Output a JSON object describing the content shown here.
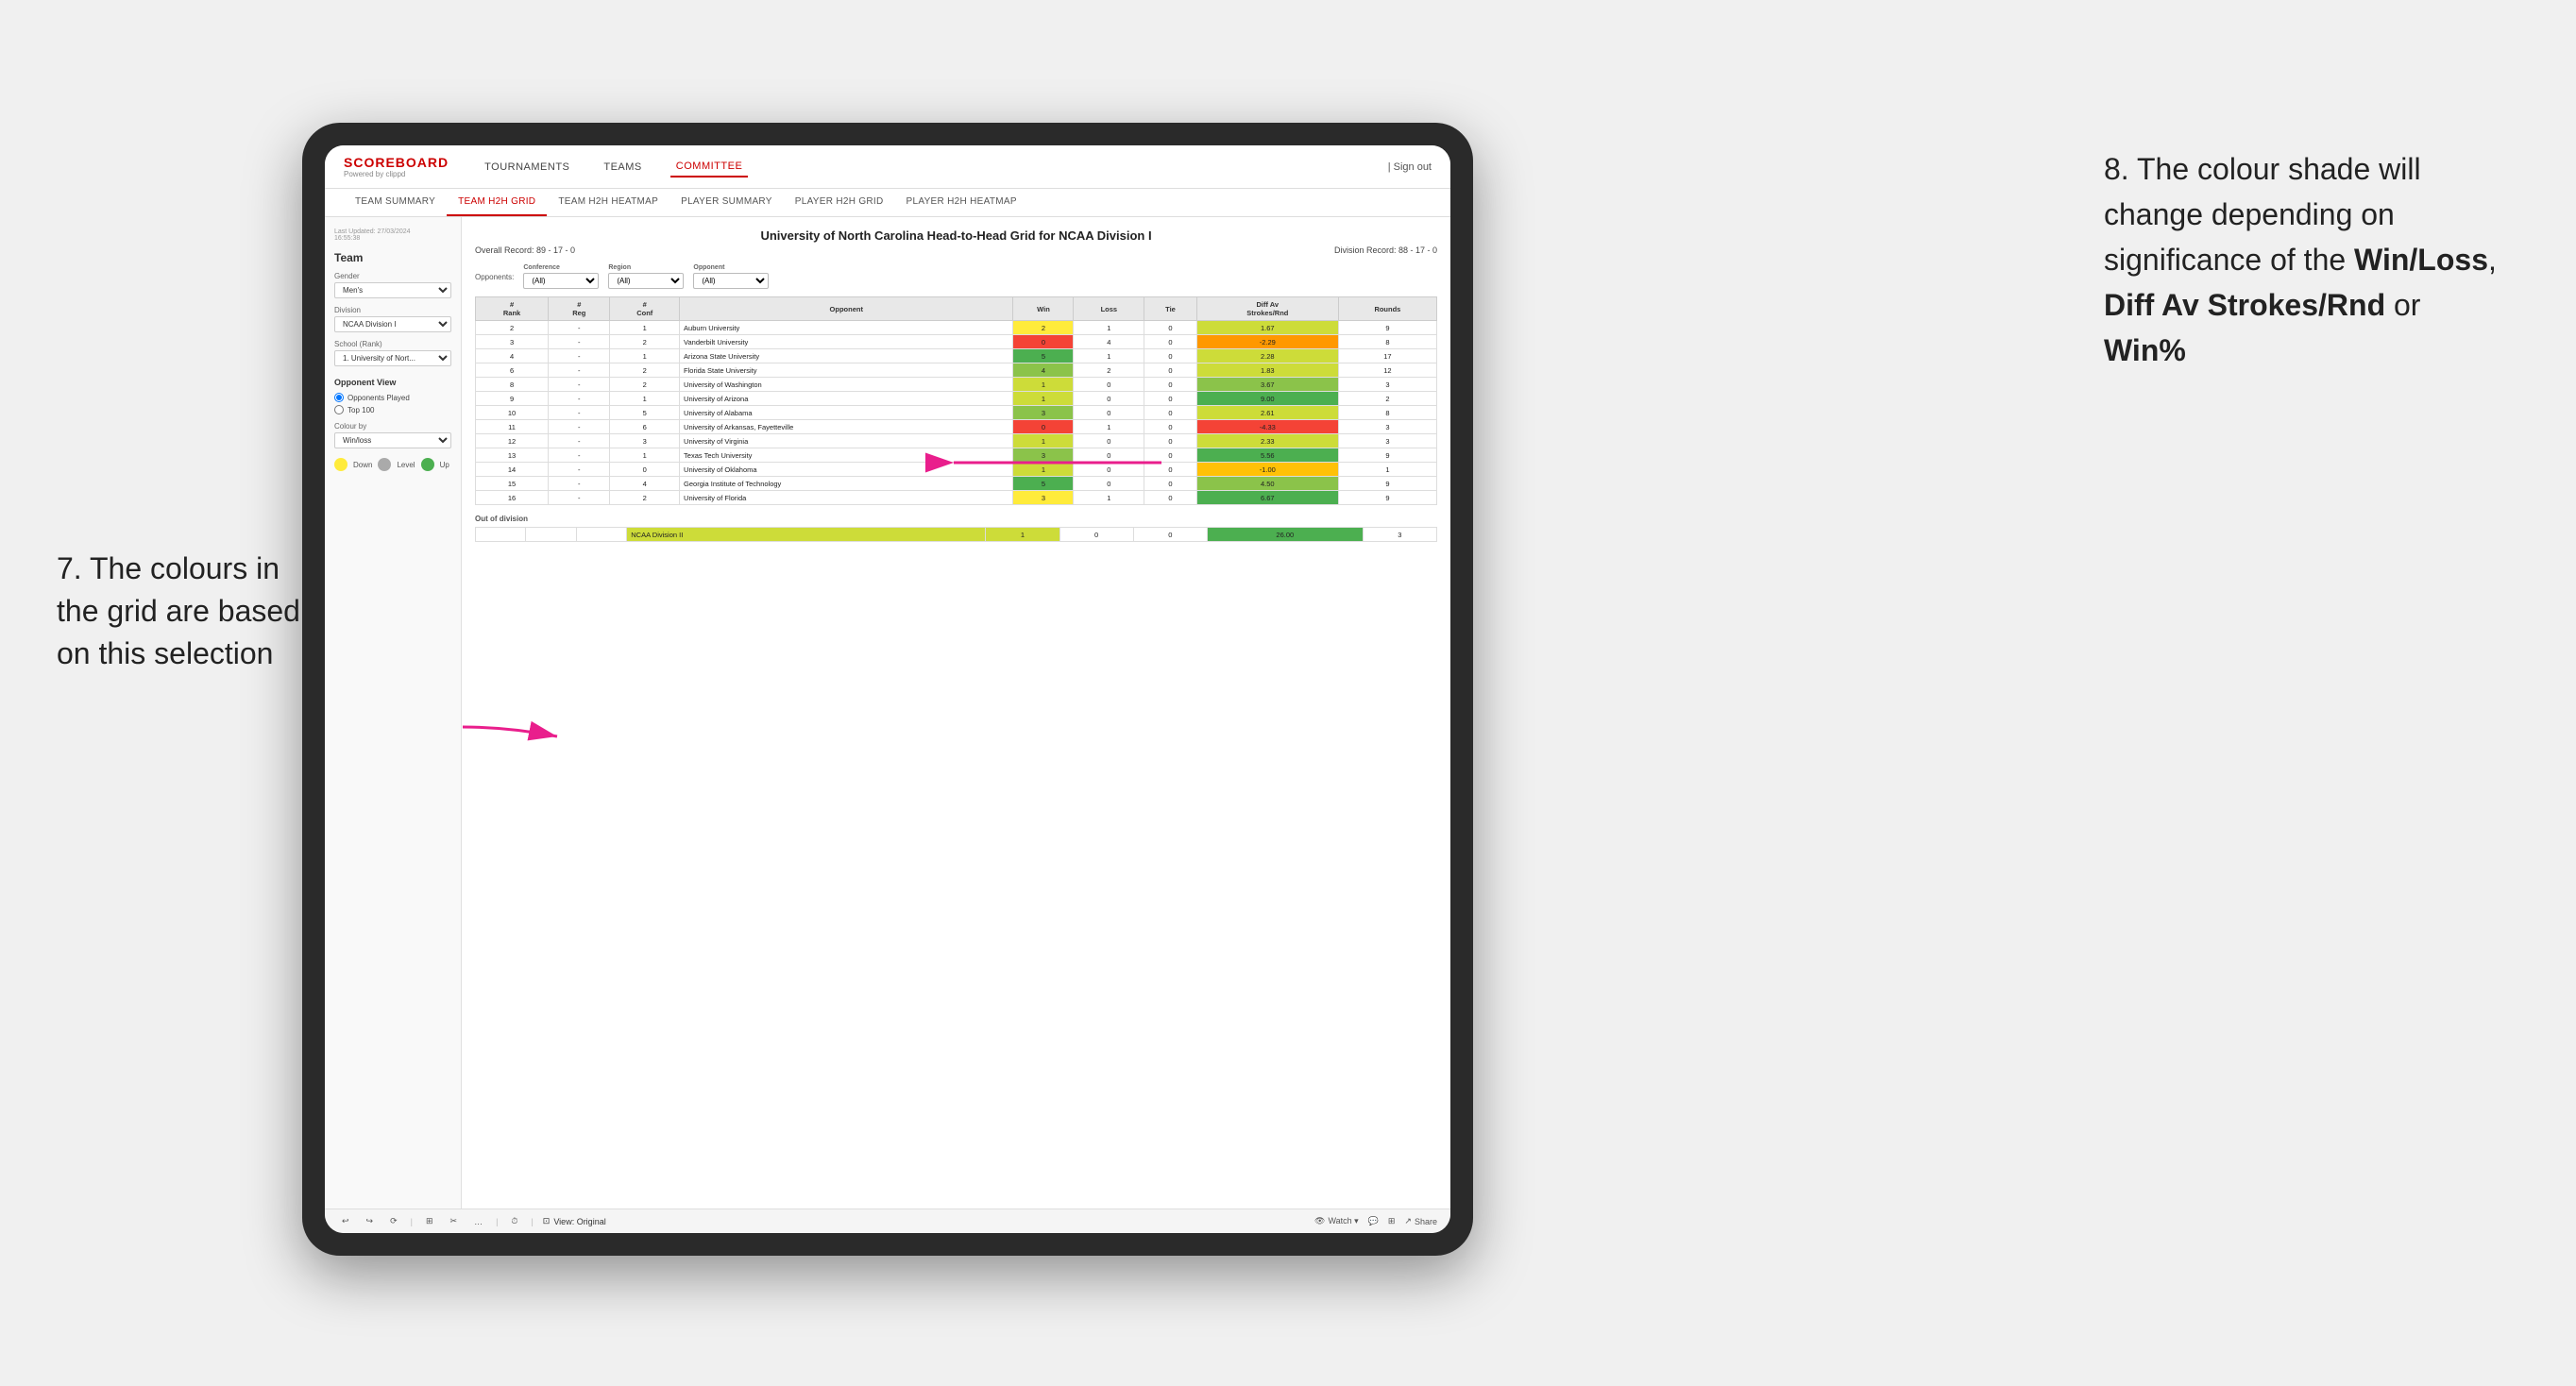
{
  "annotations": {
    "left": "7. The colours in the grid are based on this selection",
    "right_prefix": "8. The colour shade will change depending on significance of the ",
    "right_bold1": "Win/Loss",
    "right_sep1": ", ",
    "right_bold2": "Diff Av Strokes/Rnd",
    "right_sep2": " or ",
    "right_bold3": "Win%"
  },
  "nav": {
    "logo": "SCOREBOARD",
    "logo_sub": "Powered by clippd",
    "items": [
      "TOURNAMENTS",
      "TEAMS",
      "COMMITTEE"
    ],
    "active_item": "COMMITTEE",
    "sign_out": "Sign out"
  },
  "sub_nav": {
    "items": [
      "TEAM SUMMARY",
      "TEAM H2H GRID",
      "TEAM H2H HEATMAP",
      "PLAYER SUMMARY",
      "PLAYER H2H GRID",
      "PLAYER H2H HEATMAP"
    ],
    "active": "TEAM H2H GRID"
  },
  "left_panel": {
    "timestamp": "Last Updated: 27/03/2024\n16:55:38",
    "section_title": "Team",
    "gender_label": "Gender",
    "gender_value": "Men's",
    "division_label": "Division",
    "division_value": "NCAA Division I",
    "school_label": "School (Rank)",
    "school_value": "1. University of Nort...",
    "opponent_view_label": "Opponent View",
    "opponent_options": [
      "Opponents Played",
      "Top 100"
    ],
    "opponent_selected": "Opponents Played",
    "colour_by_label": "Colour by",
    "colour_by_value": "Win/loss",
    "legend": {
      "down_label": "Down",
      "level_label": "Level",
      "up_label": "Up",
      "down_color": "#ffeb3b",
      "level_color": "#aaa",
      "up_color": "#4caf50"
    }
  },
  "grid": {
    "title": "University of North Carolina Head-to-Head Grid for NCAA Division I",
    "overall_record": "Overall Record: 89 - 17 - 0",
    "division_record": "Division Record: 88 - 17 - 0",
    "filters": {
      "opponents_label": "Opponents:",
      "conference_label": "Conference",
      "conference_value": "(All)",
      "region_label": "Region",
      "region_value": "(All)",
      "opponent_label": "Opponent",
      "opponent_value": "(All)"
    },
    "table_headers": [
      "#\nRank",
      "#\nReg",
      "#\nConf",
      "Opponent",
      "Win",
      "Loss",
      "Tie",
      "Diff Av\nStrokes/Rnd",
      "Rounds"
    ],
    "rows": [
      {
        "rank": "2",
        "reg": "-",
        "conf": "1",
        "opponent": "Auburn University",
        "win": "2",
        "loss": "1",
        "tie": "0",
        "diff": "1.67",
        "rounds": "9",
        "win_color": "cell-yellow",
        "loss_color": "cell-white",
        "diff_color": "cell-green-light"
      },
      {
        "rank": "3",
        "reg": "-",
        "conf": "2",
        "opponent": "Vanderbilt University",
        "win": "0",
        "loss": "4",
        "tie": "0",
        "diff": "-2.29",
        "rounds": "8",
        "win_color": "cell-red",
        "loss_color": "cell-white",
        "diff_color": "cell-orange"
      },
      {
        "rank": "4",
        "reg": "-",
        "conf": "1",
        "opponent": "Arizona State University",
        "win": "5",
        "loss": "1",
        "tie": "0",
        "diff": "2.28",
        "rounds": "17",
        "win_color": "cell-green-dark",
        "loss_color": "cell-white",
        "diff_color": "cell-green-light"
      },
      {
        "rank": "6",
        "reg": "-",
        "conf": "2",
        "opponent": "Florida State University",
        "win": "4",
        "loss": "2",
        "tie": "0",
        "diff": "1.83",
        "rounds": "12",
        "win_color": "cell-green-med",
        "loss_color": "cell-white",
        "diff_color": "cell-green-light"
      },
      {
        "rank": "8",
        "reg": "-",
        "conf": "2",
        "opponent": "University of Washington",
        "win": "1",
        "loss": "0",
        "tie": "0",
        "diff": "3.67",
        "rounds": "3",
        "win_color": "cell-green-light",
        "loss_color": "cell-white",
        "diff_color": "cell-green-med"
      },
      {
        "rank": "9",
        "reg": "-",
        "conf": "1",
        "opponent": "University of Arizona",
        "win": "1",
        "loss": "0",
        "tie": "0",
        "diff": "9.00",
        "rounds": "2",
        "win_color": "cell-green-light",
        "loss_color": "cell-white",
        "diff_color": "cell-green-dark"
      },
      {
        "rank": "10",
        "reg": "-",
        "conf": "5",
        "opponent": "University of Alabama",
        "win": "3",
        "loss": "0",
        "tie": "0",
        "diff": "2.61",
        "rounds": "8",
        "win_color": "cell-green-med",
        "loss_color": "cell-white",
        "diff_color": "cell-green-light"
      },
      {
        "rank": "11",
        "reg": "-",
        "conf": "6",
        "opponent": "University of Arkansas, Fayetteville",
        "win": "0",
        "loss": "1",
        "tie": "0",
        "diff": "-4.33",
        "rounds": "3",
        "win_color": "cell-red",
        "loss_color": "cell-white",
        "diff_color": "cell-red"
      },
      {
        "rank": "12",
        "reg": "-",
        "conf": "3",
        "opponent": "University of Virginia",
        "win": "1",
        "loss": "0",
        "tie": "0",
        "diff": "2.33",
        "rounds": "3",
        "win_color": "cell-green-light",
        "loss_color": "cell-white",
        "diff_color": "cell-green-light"
      },
      {
        "rank": "13",
        "reg": "-",
        "conf": "1",
        "opponent": "Texas Tech University",
        "win": "3",
        "loss": "0",
        "tie": "0",
        "diff": "5.56",
        "rounds": "9",
        "win_color": "cell-green-med",
        "loss_color": "cell-white",
        "diff_color": "cell-green-dark"
      },
      {
        "rank": "14",
        "reg": "-",
        "conf": "0",
        "opponent": "University of Oklahoma",
        "win": "1",
        "loss": "0",
        "tie": "0",
        "diff": "-1.00",
        "rounds": "1",
        "win_color": "cell-green-light",
        "loss_color": "cell-white",
        "diff_color": "cell-orange-light"
      },
      {
        "rank": "15",
        "reg": "-",
        "conf": "4",
        "opponent": "Georgia Institute of Technology",
        "win": "5",
        "loss": "0",
        "tie": "0",
        "diff": "4.50",
        "rounds": "9",
        "win_color": "cell-green-dark",
        "loss_color": "cell-white",
        "diff_color": "cell-green-med"
      },
      {
        "rank": "16",
        "reg": "-",
        "conf": "2",
        "opponent": "University of Florida",
        "win": "3",
        "loss": "1",
        "tie": "0",
        "diff": "6.67",
        "rounds": "9",
        "win_color": "cell-yellow",
        "loss_color": "cell-white",
        "diff_color": "cell-green-dark"
      }
    ],
    "out_of_division_label": "Out of division",
    "out_of_division_row": {
      "division": "NCAA Division II",
      "win": "1",
      "loss": "0",
      "tie": "0",
      "diff": "26.00",
      "rounds": "3",
      "win_color": "cell-green-light",
      "diff_color": "cell-green-dark"
    }
  },
  "toolbar": {
    "buttons": [
      "↩",
      "↪",
      "↩↪",
      "⊞",
      "✂",
      "…",
      "⏱"
    ],
    "view_label": "View: Original",
    "watch_label": "Watch ▾",
    "comment_icon": "💬",
    "share_label": "Share"
  }
}
